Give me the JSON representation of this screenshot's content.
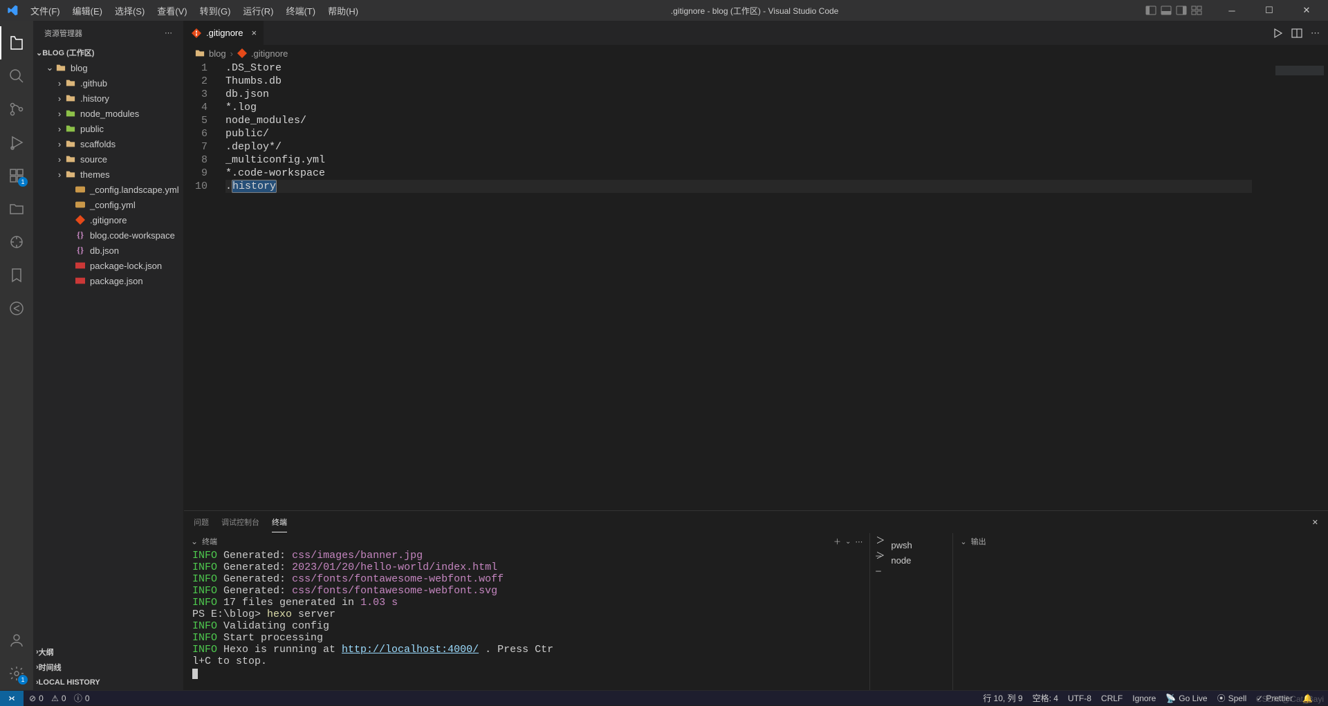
{
  "title": ".gitignore - blog (工作区) - Visual Studio Code",
  "menu": [
    "文件(F)",
    "编辑(E)",
    "选择(S)",
    "查看(V)",
    "转到(G)",
    "运行(R)",
    "终端(T)",
    "帮助(H)"
  ],
  "sidebar": {
    "header": "资源管理器",
    "root": "BLOG (工作区)",
    "tree": [
      {
        "label": "blog",
        "type": "folder",
        "depth": 0,
        "open": true,
        "color": "fld-orange"
      },
      {
        "label": ".github",
        "type": "folder",
        "depth": 1,
        "open": false,
        "color": "fld-orange"
      },
      {
        "label": ".history",
        "type": "folder",
        "depth": 1,
        "open": false,
        "color": "fld-orange"
      },
      {
        "label": "node_modules",
        "type": "folder",
        "depth": 1,
        "open": false,
        "color": "fld-green"
      },
      {
        "label": "public",
        "type": "folder",
        "depth": 1,
        "open": false,
        "color": "fld-green"
      },
      {
        "label": "scaffolds",
        "type": "folder",
        "depth": 1,
        "open": false,
        "color": "fld-orange"
      },
      {
        "label": "source",
        "type": "folder",
        "depth": 1,
        "open": false,
        "color": "fld-orange"
      },
      {
        "label": "themes",
        "type": "folder",
        "depth": 1,
        "open": false,
        "color": "fld-orange"
      },
      {
        "label": "_config.landscape.yml",
        "type": "file",
        "depth": 2,
        "icon": "yml"
      },
      {
        "label": "_config.yml",
        "type": "file",
        "depth": 2,
        "icon": "yml"
      },
      {
        "label": ".gitignore",
        "type": "file",
        "depth": 2,
        "icon": "git"
      },
      {
        "label": "blog.code-workspace",
        "type": "file",
        "depth": 2,
        "icon": "brace"
      },
      {
        "label": "db.json",
        "type": "file",
        "depth": 2,
        "icon": "brace"
      },
      {
        "label": "package-lock.json",
        "type": "file",
        "depth": 2,
        "icon": "npm"
      },
      {
        "label": "package.json",
        "type": "file",
        "depth": 2,
        "icon": "npm"
      }
    ],
    "outline": "大纲",
    "timeline": "时间线",
    "localhistory": "LOCAL HISTORY"
  },
  "activitybar": {
    "ext_badge": "1",
    "settings_badge": "1"
  },
  "tab": {
    "label": ".gitignore"
  },
  "breadcrumb": [
    "blog",
    ".gitignore"
  ],
  "editor": {
    "lines": [
      ".DS_Store",
      "Thumbs.db",
      "db.json",
      "*.log",
      "node_modules/",
      "public/",
      ".deploy*/",
      "_multiconfig.yml",
      "*.code-workspace",
      ".history"
    ],
    "cursor_line": 10
  },
  "panel": {
    "tabs": [
      "问题",
      "调试控制台",
      "终端"
    ],
    "active": 2,
    "term_title": "终端",
    "output_title": "输出",
    "tasks": [
      "pwsh",
      "node"
    ],
    "terminal_lines": [
      {
        "type": "info",
        "gen": "Generated: ",
        "path": "css/images/banner.jpg"
      },
      {
        "type": "info",
        "gen": "Generated: ",
        "path": "2023/01/20/hello-world/index.html"
      },
      {
        "type": "info",
        "gen": "Generated: ",
        "path": "css/fonts/fontawesome-webfont.woff"
      },
      {
        "type": "info",
        "gen": "Generated: ",
        "path": "css/fonts/fontawesome-webfont.svg"
      },
      {
        "type": "info_text",
        "text": "17 files generated in ",
        "time": "1.03 s"
      },
      {
        "type": "prompt",
        "prompt": "PS E:\\blog> ",
        "cmd": "hexo",
        "arg": " server"
      },
      {
        "type": "info_plain",
        "text": "Validating config"
      },
      {
        "type": "info_plain",
        "text": "Start processing"
      },
      {
        "type": "info_url",
        "pre": "Hexo is running at ",
        "url": "http://localhost:4000/",
        "post": " . Press Ctr"
      },
      {
        "type": "wrap",
        "text": "l+C to stop."
      }
    ]
  },
  "status": {
    "errors": "0",
    "warnings": "0",
    "info": "0",
    "line_col": "行 10, 列 9",
    "spaces": "空格: 4",
    "encoding": "UTF-8",
    "eol": "CRLF",
    "lang": "Ignore",
    "golive": "Go Live",
    "spell": "Spell",
    "prettier": "Prettier",
    "bell": ""
  },
  "watermark": "CSDN @Cat_Bayi"
}
